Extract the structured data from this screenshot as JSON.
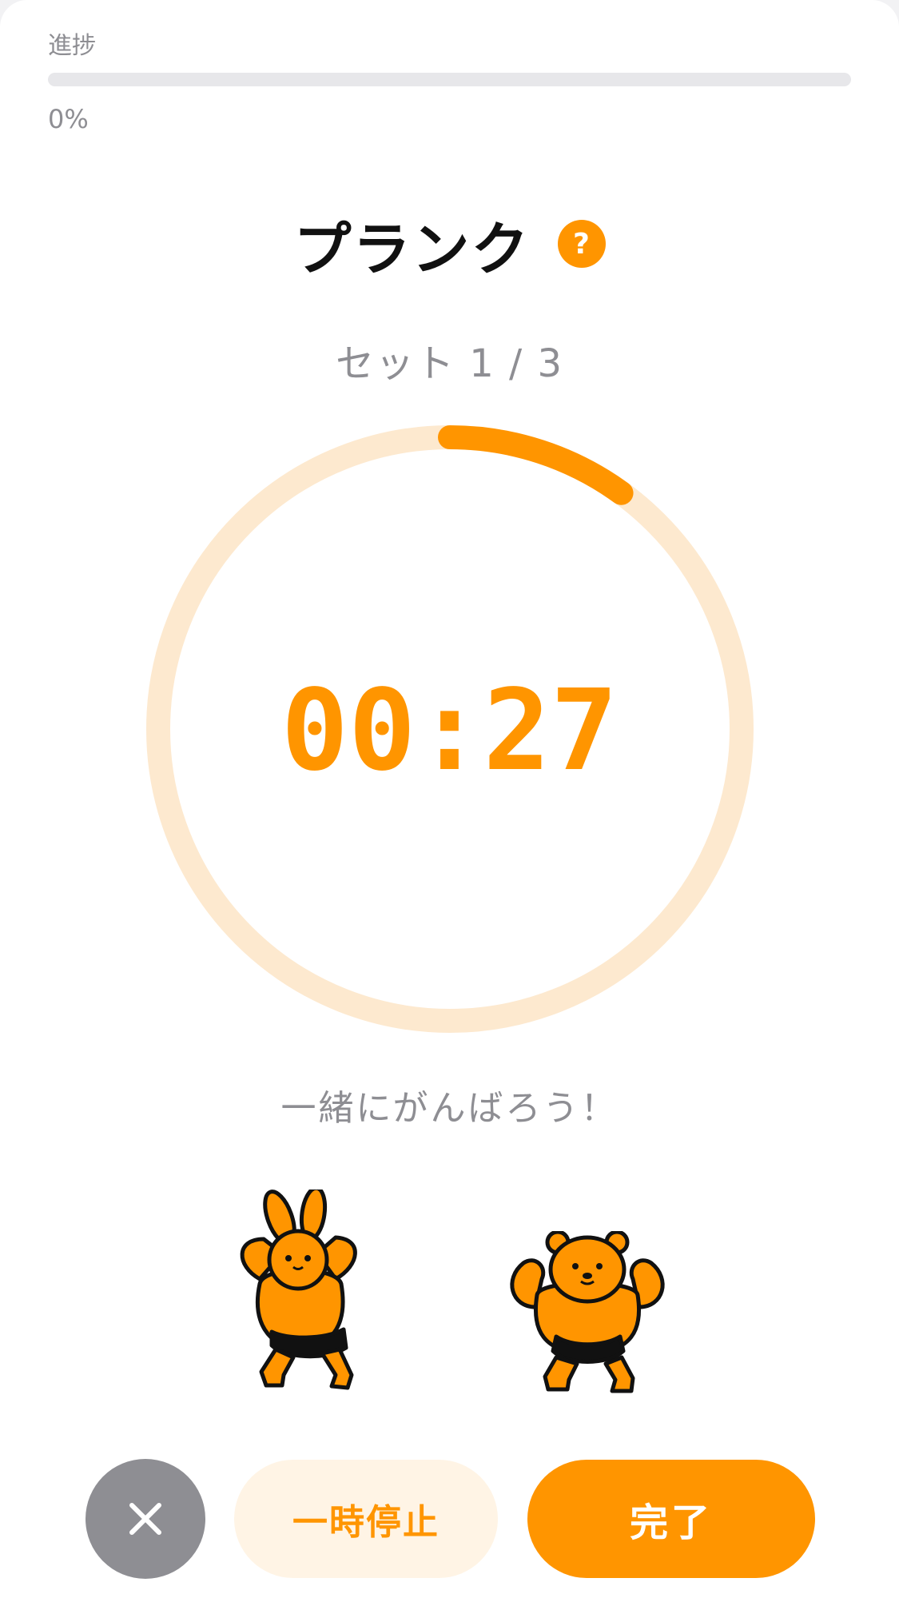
{
  "progress": {
    "label": "進捗",
    "value_text": "0%",
    "fraction": 0
  },
  "exercise": {
    "title": "プランク",
    "help_symbol": "?"
  },
  "set": {
    "label": "セット 1 / 3"
  },
  "timer": {
    "display": "00:27",
    "ring_fraction": 0.1
  },
  "cheer": "一緒にがんばろう！",
  "mascots": {
    "left_icon": "muscle-rabbit-icon",
    "right_icon": "muscle-bear-icon"
  },
  "actions": {
    "close_icon": "close-icon",
    "pause_label": "一時停止",
    "done_label": "完了"
  },
  "colors": {
    "accent": "#ff9500",
    "accent_light": "#fde9cf",
    "muted_text": "#8e8e93",
    "close_button": "#8e8e93",
    "pause_bg": "#fff4e5"
  }
}
